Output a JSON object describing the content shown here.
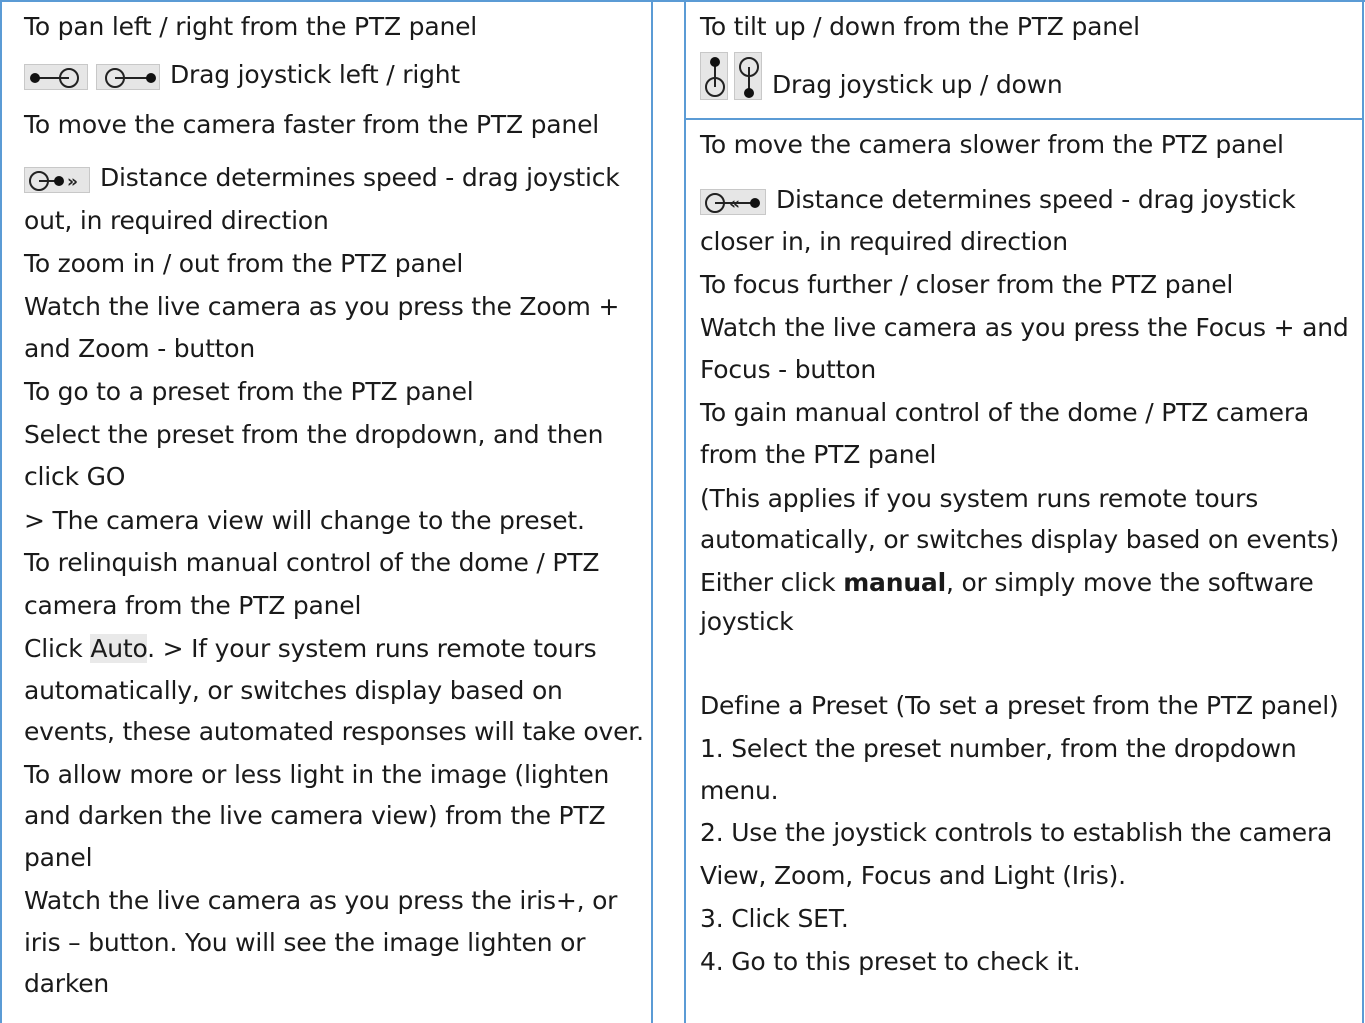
{
  "left": {
    "pan_heading": "To pan left / right from the PTZ panel",
    "pan_text": "Drag joystick left / right",
    "faster_heading": "To move the camera faster from the PTZ panel",
    "faster_text_1": "Distance determines speed - drag joystick",
    "faster_text_2": "out, in required direction",
    "zoom_heading": "To zoom in / out from the PTZ panel",
    "zoom_text_1": "Watch the live camera as you press the Zoom +",
    "zoom_text_2": "and Zoom - button",
    "preset_heading": "To go to a preset from the PTZ panel",
    "preset_text_1": "Select the preset from the dropdown, and then",
    "preset_text_2": "click GO",
    "preset_text_3": "> The camera view will change to the preset.",
    "relinquish_heading_1": "To relinquish manual control of the dome / PTZ",
    "relinquish_heading_2": "camera from the PTZ panel",
    "relinquish_click": "Click ",
    "relinquish_auto": "Auto",
    "relinquish_text_1": ". > If your system runs remote tours",
    "relinquish_text_2": "automatically, or switches display based on",
    "relinquish_text_3": "events, these automated responses will take over.",
    "light_heading_1": "To allow more or less light in the image (lighten",
    "light_heading_2": "and darken the live camera view) from the PTZ",
    "light_heading_3": "panel",
    "light_text_1": "Watch the live camera as you press the iris+, or",
    "light_text_2": "iris – button. You will see the image lighten or",
    "light_text_3": "darken"
  },
  "right": {
    "tilt_heading": "To tilt up / down from the PTZ panel",
    "tilt_text": "Drag joystick up / down",
    "slower_heading": "To move the camera slower from the PTZ panel",
    "slower_text_1": "Distance determines speed - drag joystick",
    "slower_text_2": "closer in, in required direction",
    "focus_heading": "To focus further / closer from the PTZ panel",
    "focus_text_1": "Watch the live camera as you press the Focus + and",
    "focus_text_2": "Focus - button",
    "manual_heading_1": "To gain manual control of the dome / PTZ camera",
    "manual_heading_2": "from the PTZ panel",
    "manual_text_1": "(This applies if you system runs remote tours",
    "manual_text_2": "automatically, or switches display based on events)",
    "manual_either": "Either click ",
    "manual_bold": "manual",
    "manual_rest": ", or simply move the software",
    "manual_text_4": "joystick",
    "define_heading": "Define a Preset (To set a preset from the PTZ panel)",
    "step1_a": "1. Select the preset number, from the dropdown",
    "step1_b": "menu.",
    "step2_a": "2. Use the joystick controls to establish the camera",
    "step2_b": "View, Zoom, Focus and Light (Iris).",
    "step3": "3. Click SET.",
    "step4": "4. Go to this preset to check it."
  },
  "colors": {
    "border": "#5b9bd5",
    "text": "#1a1a1a",
    "icon_bg": "#e6e6e6"
  },
  "icons": [
    "pan-left-icon",
    "pan-right-icon",
    "tilt-up-icon",
    "tilt-down-icon",
    "faster-icon",
    "slower-icon"
  ]
}
